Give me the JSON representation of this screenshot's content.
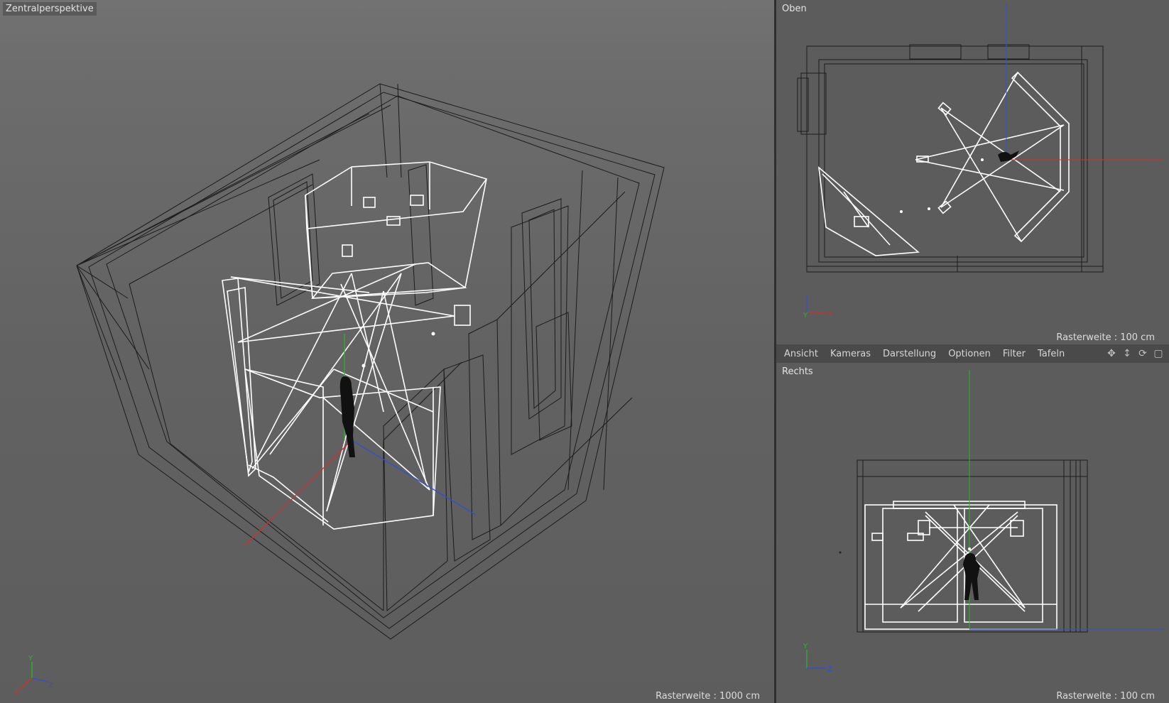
{
  "viewports": {
    "perspective": {
      "label": "Zentralperspektive",
      "grid": "Rasterweite : 1000 cm"
    },
    "top": {
      "label": "Oben",
      "grid": "Rasterweite : 100 cm"
    },
    "right": {
      "label": "Rechts",
      "grid": "Rasterweite : 100 cm"
    }
  },
  "menu": {
    "items": [
      "Ansicht",
      "Kameras",
      "Darstellung",
      "Optionen",
      "Filter",
      "Tafeln"
    ],
    "icons": [
      "move-icon",
      "zoom-icon",
      "rotate-icon",
      "maximize-icon"
    ]
  },
  "axes": {
    "x": "X",
    "y": "Y",
    "z": "Z"
  },
  "colors": {
    "x_axis": "#d03030",
    "y_axis": "#30b030",
    "z_axis": "#3050d0",
    "wire_selected": "#ffffff",
    "wire": "#1c1c1c"
  }
}
